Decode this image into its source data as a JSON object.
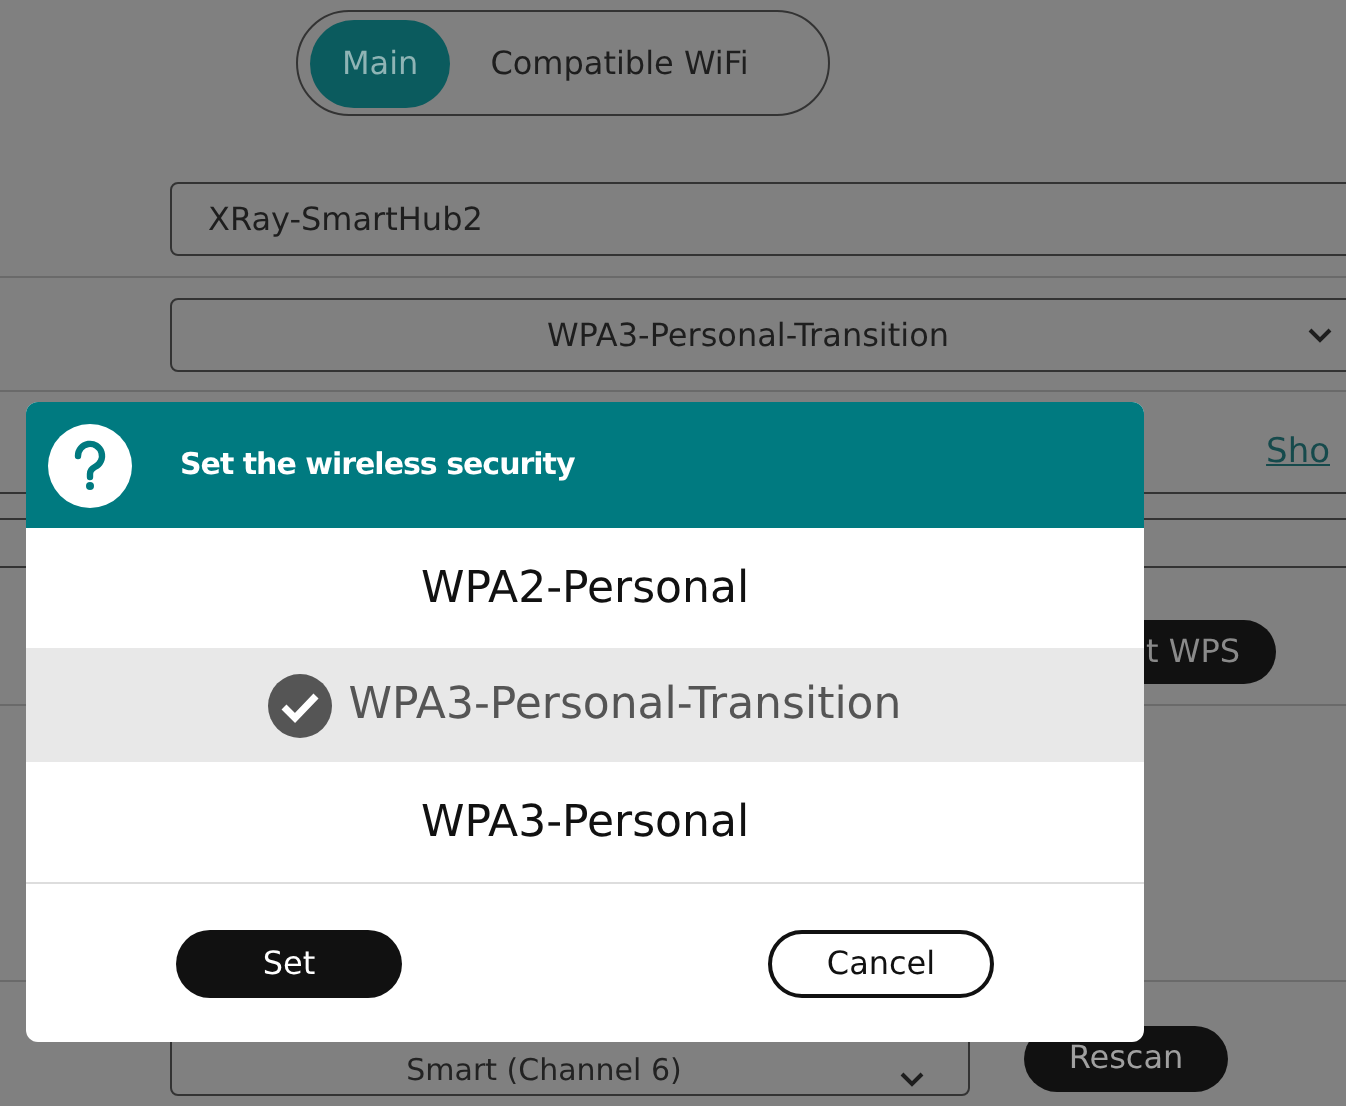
{
  "tabs": [
    {
      "label": "Main",
      "selected": true
    },
    {
      "label": "Compatible WiFi",
      "selected": false
    }
  ],
  "network_name": {
    "value": "XRay-SmartHub2"
  },
  "security_select": {
    "value": "WPA3-Personal-Transition"
  },
  "password_link": "Sho",
  "wps_button": "t WPS",
  "channel_select": {
    "value": "Smart (Channel 6)"
  },
  "rescan_button": "Rescan",
  "dialog": {
    "title": "Set the wireless security",
    "options": [
      {
        "label": "WPA2-Personal",
        "selected": false
      },
      {
        "label": "WPA3-Personal-Transition",
        "selected": true
      },
      {
        "label": "WPA3-Personal",
        "selected": false
      }
    ],
    "buttons": [
      {
        "label": "Set",
        "kind": "primary"
      },
      {
        "label": "Cancel",
        "kind": "secondary"
      }
    ]
  }
}
